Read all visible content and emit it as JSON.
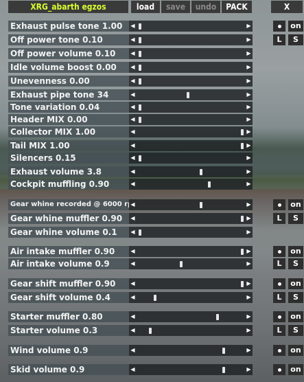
{
  "header": {
    "title": "XRG_abarth egzos",
    "load": "load",
    "save": "save",
    "undo": "undo",
    "pack": "PACK",
    "close": "X"
  },
  "colors": {
    "title": "#d8ff30",
    "label_bg": "#465055",
    "track_bg": "#1e2224",
    "button_bg": "#2e2e2e"
  },
  "icons": {
    "left": "arrow-left-icon",
    "right": "arrow-right-icon",
    "dot": "dot-icon"
  },
  "groups": [
    {
      "buttons": [
        "on",
        "L",
        "S"
      ],
      "sliders": [
        {
          "label": "Exhaust pulse tone 1.00",
          "value": 0.0
        },
        {
          "label": "Off power tone 0.10",
          "value": 0.0
        },
        {
          "label": "Off power volume 0.10",
          "value": 0.0
        },
        {
          "label": "Idle volume boost 0.00",
          "value": 0.0
        },
        {
          "label": "Unevenness 0.00",
          "value": 0.0
        },
        {
          "label": "Exhaust pipe tone 34",
          "value": 0.47
        },
        {
          "label": "Tone variation 0.04",
          "value": 0.0
        },
        {
          "label": "Header MIX 0.00",
          "value": 0.0
        },
        {
          "label": "Collector MIX 1.00",
          "value": 1.0
        },
        {
          "label": "Tail MIX 1.00",
          "value": 1.0
        },
        {
          "label": "Silencers 0.15",
          "value": 0.0
        },
        {
          "label": "Exhaust volume 3.8",
          "value": 0.6
        },
        {
          "label": "Cockpit muffling 0.90",
          "value": 0.68
        }
      ]
    },
    {
      "buttons": [
        "on",
        "L",
        "S"
      ],
      "sliders": [
        {
          "label": "Gear whine recorded @ 6000 rpm",
          "value": 0.6
        },
        {
          "label": "Gear whine muffler 0.90",
          "value": 1.0
        },
        {
          "label": "Gear whine volume 0.1",
          "value": 0.0
        }
      ]
    },
    {
      "buttons": [
        "on",
        "L",
        "S"
      ],
      "sliders": [
        {
          "label": "Air intake muffler 0.90",
          "value": 1.0
        },
        {
          "label": "Air intake volume 0.9",
          "value": 0.4
        }
      ]
    },
    {
      "buttons": [
        "on",
        "L",
        "S"
      ],
      "sliders": [
        {
          "label": "Gear shift muffler 0.90",
          "value": 1.0
        },
        {
          "label": "Gear shift volume 0.4",
          "value": 0.15
        }
      ]
    },
    {
      "buttons": [
        "on",
        "L",
        "S"
      ],
      "sliders": [
        {
          "label": "Starter muffler 0.80",
          "value": 0.76
        },
        {
          "label": "Starter volume 0.3",
          "value": 0.1
        }
      ]
    },
    {
      "buttons": [
        "on"
      ],
      "sliders": [
        {
          "label": "Wind volume 0.9",
          "value": 0.82
        }
      ]
    },
    {
      "buttons": [
        "on"
      ],
      "sliders": [
        {
          "label": "Skid volume 0.9",
          "value": 0.82
        }
      ]
    }
  ]
}
